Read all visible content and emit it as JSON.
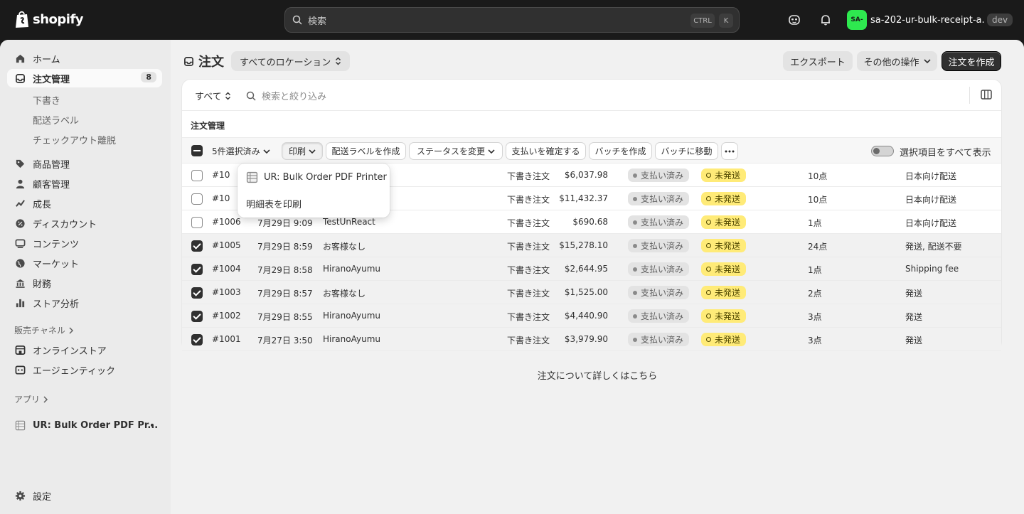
{
  "topbar": {
    "logo_text": "shopify",
    "search_placeholder": "検索",
    "kbd_ctrl": "CTRL",
    "kbd_k": "K",
    "store_avatar": "SA-",
    "store_name": "sa-202-ur-bulk-receipt-a...",
    "store_badge": "dev"
  },
  "sidebar": {
    "items": [
      {
        "label": "ホーム",
        "icon": "home-icon"
      },
      {
        "label": "注文管理",
        "icon": "orders-icon",
        "count": "8"
      },
      {
        "label": "商品管理",
        "icon": "tag-icon"
      },
      {
        "label": "顧客管理",
        "icon": "person-icon"
      },
      {
        "label": "成長",
        "icon": "growth-icon"
      },
      {
        "label": "ディスカウント",
        "icon": "discount-icon"
      },
      {
        "label": "コンテンツ",
        "icon": "content-icon"
      },
      {
        "label": "マーケット",
        "icon": "globe-icon"
      },
      {
        "label": "財務",
        "icon": "bank-icon"
      },
      {
        "label": "ストア分析",
        "icon": "chart-icon"
      }
    ],
    "sub_items": [
      "下書き",
      "配送ラベル",
      "チェックアウト離脱"
    ],
    "sales_channels_label": "販売チャネル",
    "channels": [
      {
        "label": "オンラインストア",
        "icon": "store-icon"
      },
      {
        "label": "エージェンティック",
        "icon": "agentic-icon"
      }
    ],
    "apps_label": "アプリ",
    "app_item": "UR: Bulk Order PDF Pr...",
    "settings_label": "設定"
  },
  "header": {
    "title": "注文",
    "location_button": "すべてのロケーション",
    "export_button": "エクスポート",
    "more_actions_button": "その他の操作",
    "create_button": "注文を作成"
  },
  "filter": {
    "tab_all": "すべて",
    "search_placeholder": "検索と絞り込み"
  },
  "table": {
    "section_title": "注文管理",
    "bulk": {
      "selected_label": "5件選択済み",
      "print": "印刷",
      "create_label": "配送ラベルを作成",
      "change_status": "ステータスを変更",
      "confirm_payment": "支払いを確定する",
      "create_batch": "バッチを作成",
      "move_batch": "バッチに移動",
      "show_selected": "選択項目をすべて表示"
    },
    "rows": [
      {
        "order": "#10",
        "date": "",
        "customer": "",
        "channel": "下書き注文",
        "total": "$6,037.98",
        "payment": "支払い済み",
        "fulfillment": "未発送",
        "items": "10点",
        "delivery": "日本向け配送",
        "selected": false
      },
      {
        "order": "#10",
        "date": "",
        "customer": "",
        "channel": "下書き注文",
        "total": "$11,432.37",
        "payment": "支払い済み",
        "fulfillment": "未発送",
        "items": "10点",
        "delivery": "日本向け配送",
        "selected": false
      },
      {
        "order": "#1006",
        "date": "7月29日 9:09",
        "customer": "TestUnReact",
        "channel": "下書き注文",
        "total": "$690.68",
        "payment": "支払い済み",
        "fulfillment": "未発送",
        "items": "1点",
        "delivery": "日本向け配送",
        "selected": false
      },
      {
        "order": "#1005",
        "date": "7月29日 8:59",
        "customer": "お客様なし",
        "channel": "下書き注文",
        "total": "$15,278.10",
        "payment": "支払い済み",
        "fulfillment": "未発送",
        "items": "24点",
        "delivery": "発送, 配送不要",
        "selected": true
      },
      {
        "order": "#1004",
        "date": "7月29日 8:58",
        "customer": "HiranoAyumu",
        "channel": "下書き注文",
        "total": "$2,644.95",
        "payment": "支払い済み",
        "fulfillment": "未発送",
        "items": "1点",
        "delivery": "Shipping fee",
        "selected": true
      },
      {
        "order": "#1003",
        "date": "7月29日 8:57",
        "customer": "お客様なし",
        "channel": "下書き注文",
        "total": "$1,525.00",
        "payment": "支払い済み",
        "fulfillment": "未発送",
        "items": "2点",
        "delivery": "発送",
        "selected": true
      },
      {
        "order": "#1002",
        "date": "7月29日 8:55",
        "customer": "HiranoAyumu",
        "channel": "下書き注文",
        "total": "$4,440.90",
        "payment": "支払い済み",
        "fulfillment": "未発送",
        "items": "3点",
        "delivery": "発送",
        "selected": true
      },
      {
        "order": "#1001",
        "date": "7月27日 3:50",
        "customer": "HiranoAyumu",
        "channel": "下書き注文",
        "total": "$3,979.90",
        "payment": "支払い済み",
        "fulfillment": "未発送",
        "items": "3点",
        "delivery": "発送",
        "selected": true
      }
    ]
  },
  "print_menu": {
    "items": [
      "UR: Bulk Order PDF Printer",
      "明細表を印刷"
    ]
  },
  "footer": {
    "learn_more": "注文について詳しくはこちら"
  },
  "colors": {
    "topbar_bg": "#1a1a1a",
    "store_avatar": "#2ee94f",
    "fulfillment_badge": "#ffeb78",
    "primary_button": "#303030"
  }
}
